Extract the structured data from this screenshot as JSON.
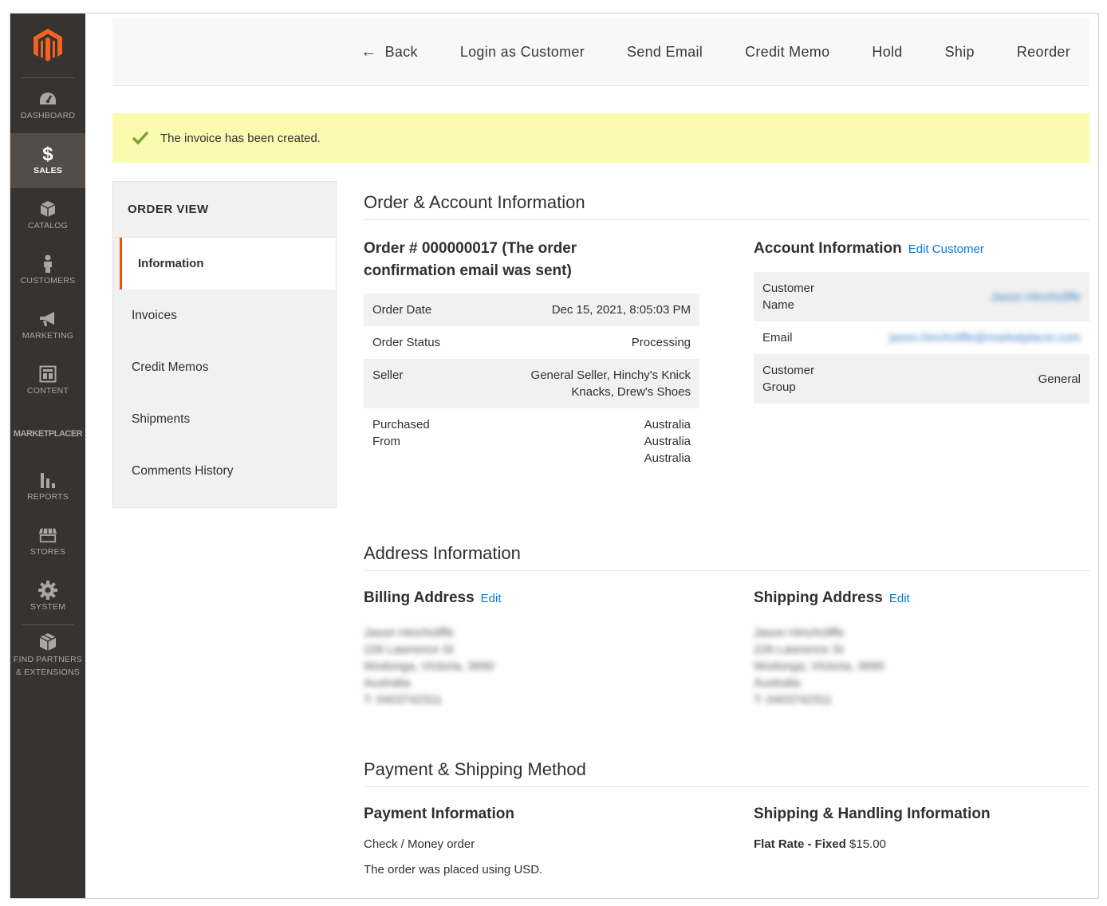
{
  "sidebar": {
    "logo_icon": "magento-logo-icon",
    "items": [
      {
        "label": "DASHBOARD",
        "icon": "dashboard-icon"
      },
      {
        "label": "SALES",
        "icon": "dollar-icon"
      },
      {
        "label": "CATALOG",
        "icon": "box-icon"
      },
      {
        "label": "CUSTOMERS",
        "icon": "person-icon"
      },
      {
        "label": "MARKETING",
        "icon": "megaphone-icon"
      },
      {
        "label": "CONTENT",
        "icon": "layout-icon"
      },
      {
        "label": "MARKETPLACER"
      },
      {
        "label": "REPORTS",
        "icon": "bar-chart-icon"
      },
      {
        "label": "STORES",
        "icon": "storefront-icon"
      },
      {
        "label": "SYSTEM",
        "icon": "gear-icon"
      },
      {
        "label": "FIND PARTNERS & EXTENSIONS",
        "icon": "cube-icon"
      }
    ]
  },
  "actions": {
    "back": "Back",
    "login_as_customer": "Login as Customer",
    "send_email": "Send Email",
    "credit_memo": "Credit Memo",
    "hold": "Hold",
    "ship": "Ship",
    "reorder": "Reorder"
  },
  "message": {
    "text": "The invoice has been created.",
    "color": "#fbfbb0"
  },
  "order_nav": {
    "title": "ORDER VIEW",
    "tabs": [
      "Information",
      "Invoices",
      "Credit Memos",
      "Shipments",
      "Comments History"
    ]
  },
  "order_account": {
    "section_title": "Order & Account Information",
    "order_title": "Order # 000000017 (The order confirmation email was sent)",
    "rows": {
      "order_date_label": "Order Date",
      "order_date_value": "Dec 15, 2021, 8:05:03 PM",
      "order_status_label": "Order Status",
      "order_status_value": "Processing",
      "seller_label": "Seller",
      "seller_value": "General Seller, Hinchy's Knick Knacks, Drew's Shoes",
      "purchased_label": "Purchased From",
      "purchased_value_1": "Australia",
      "purchased_value_2": "Australia",
      "purchased_value_3": "Australia"
    },
    "account_title": "Account Information",
    "edit_customer": "Edit Customer",
    "account_rows": {
      "name_label": "Customer Name",
      "name_value": "Jason Hinchcliffe",
      "email_label": "Email",
      "email_value": "jason.hinchcliffe@marketplacer.com",
      "group_label": "Customer Group",
      "group_value": "General"
    }
  },
  "address": {
    "section_title": "Address Information",
    "billing_title": "Billing Address",
    "shipping_title": "Shipping Address",
    "edit": "Edit",
    "billing_lines": [
      "Jason Hinchcliffe",
      "226 Lawrence St",
      "Wodonga, Victoria, 3690",
      "Australia",
      "T: 0403742311"
    ],
    "shipping_lines": [
      "Jason Hinchcliffe",
      "226 Lawrence St",
      "Wodonga, Victoria, 3690",
      "Australia",
      "T: 0403742311"
    ]
  },
  "payment": {
    "section_title": "Payment & Shipping Method",
    "payment_title": "Payment Information",
    "payment_method": "Check / Money order",
    "currency_note": "The order was placed using USD.",
    "shipping_title": "Shipping & Handling Information",
    "shipping_method": "Flat Rate - Fixed",
    "shipping_price": "$15.00"
  },
  "colors": {
    "sidebar": "#373330",
    "accent": "#eb5202",
    "link": "#007bdb"
  }
}
